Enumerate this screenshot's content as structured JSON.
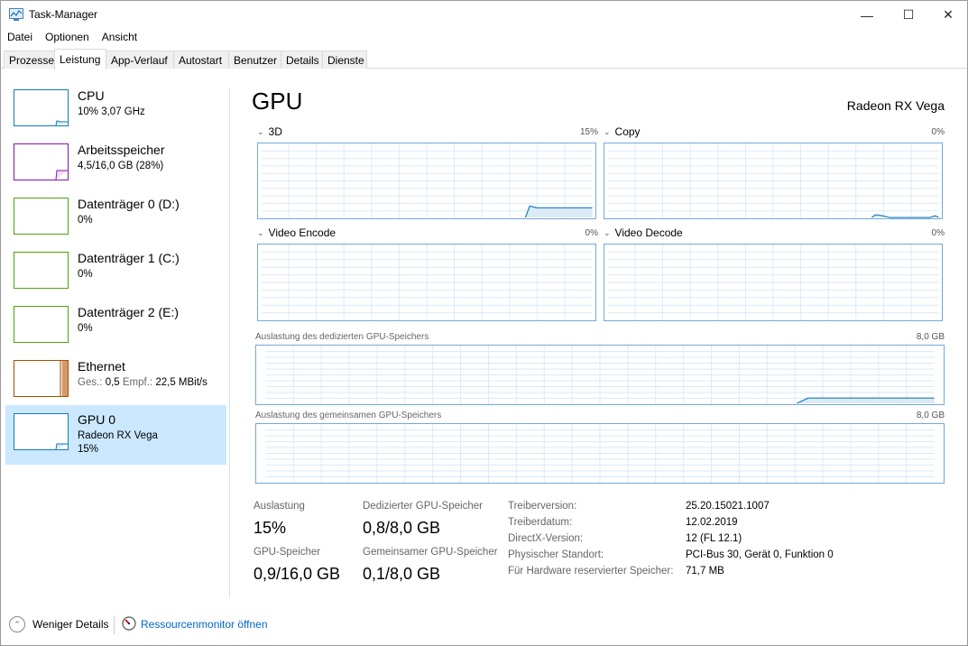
{
  "window": {
    "title": "Task-Manager",
    "icon": "task-manager-icon",
    "minimize_glyph": "—",
    "maximize_glyph": "☐",
    "close_glyph": "✕"
  },
  "menu": [
    "Datei",
    "Optionen",
    "Ansicht"
  ],
  "tabs": [
    "Prozesse",
    "Leistung",
    "App-Verlauf",
    "Autostart",
    "Benutzer",
    "Details",
    "Dienste"
  ],
  "active_tab": "Leistung",
  "sidebar": {
    "items": [
      {
        "name": "CPU",
        "line1": "10% 3,07 GHz",
        "color": "#117dbb",
        "level": 0.1
      },
      {
        "name": "Arbeitsspeicher",
        "line1": "4,5/16,0 GB (28%)",
        "color": "#8b12ae",
        "level": 0.28
      },
      {
        "name": "Datenträger 0 (D:)",
        "line1": "0%",
        "color": "#4da60c",
        "level": 0
      },
      {
        "name": "Datenträger 1 (C:)",
        "line1": "0%",
        "color": "#4da60c",
        "level": 0
      },
      {
        "name": "Datenträger 2 (E:)",
        "line1": "0%",
        "color": "#4da60c",
        "level": 0
      },
      {
        "name": "Ethernet",
        "send_label": "Ges.:",
        "send_value": "0,5",
        "recv_label": "Empf.:",
        "recv_value": "22,5 MBit/s",
        "color": "#a74f01"
      },
      {
        "name": "GPU 0",
        "line1": "Radeon RX Vega",
        "line2": "15%",
        "color": "#117dbb",
        "level": 0.15,
        "selected": true
      }
    ]
  },
  "main": {
    "title": "GPU",
    "model": "Radeon RX Vega",
    "graphs": [
      {
        "label": "3D",
        "value": "15%"
      },
      {
        "label": "Copy",
        "value": "0%"
      },
      {
        "label": "Video Encode",
        "value": "0%"
      },
      {
        "label": "Video Decode",
        "value": "0%"
      }
    ],
    "memory_graphs": [
      {
        "label": "Auslastung des dedizierten GPU-Speichers",
        "max": "8,0 GB"
      },
      {
        "label": "Auslastung des gemeinsamen GPU-Speichers",
        "max": "8,0 GB"
      }
    ],
    "stats": [
      {
        "label": "Auslastung",
        "value": "15%"
      },
      {
        "label": "Dedizierter GPU-Speicher",
        "value": "0,8/8,0 GB"
      },
      {
        "label": "GPU-Speicher",
        "value": "0,9/16,0 GB"
      },
      {
        "label": "Gemeinsamer GPU-Speicher",
        "value": "0,1/8,0 GB"
      }
    ],
    "info": [
      {
        "label": "Treiberversion:",
        "value": "25.20.15021.1007"
      },
      {
        "label": "Treiberdatum:",
        "value": "12.02.2019"
      },
      {
        "label": "DirectX-Version:",
        "value": "12 (FL 12.1)"
      },
      {
        "label": "Physischer Standort:",
        "value": "PCI-Bus 30, Gerät 0, Funktion 0"
      },
      {
        "label": "Für Hardware reservierter Speicher:",
        "value": "71,7 MB"
      }
    ],
    "graph_color": "#117dbb",
    "grid_color": "#d9eaf7"
  },
  "footer": {
    "fewer_details": "Weniger Details",
    "fewer_icon": "chevron-up-circle-icon",
    "resmon_icon": "resource-monitor-icon",
    "resmon_link": "Ressourcenmonitor öffnen"
  }
}
